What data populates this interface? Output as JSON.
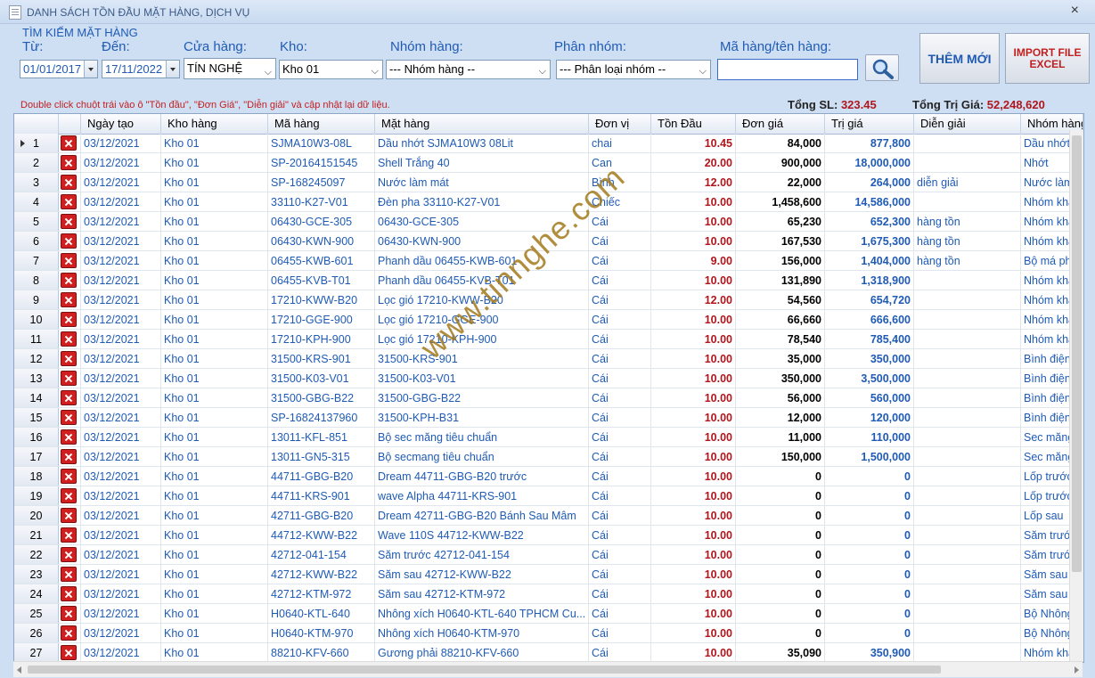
{
  "window": {
    "title": "DANH SÁCH TỒN ĐẦU MẶT HÀNG, DỊCH VỤ",
    "close_glyph": "×"
  },
  "search": {
    "title": "TÌM KIẾM MẶT HÀNG",
    "from_label": "Từ:",
    "from_value": "01/01/2017",
    "to_label": "Đến:",
    "to_value": "17/11/2022",
    "store_label": "Cửa hàng:",
    "store_value": "TÍN NGHỆ",
    "warehouse_label": "Kho:",
    "warehouse_value": "Kho 01",
    "group_label": "Nhóm hàng:",
    "group_value": "--- Nhóm hàng --",
    "subgroup_label": "Phân nhóm:",
    "subgroup_value": "--- Phân loại nhóm --",
    "code_label": "Mã hàng/tên hàng:",
    "code_value": "",
    "chevron": "⌵"
  },
  "buttons": {
    "add": "THÊM MỚI",
    "import_line1": "IMPORT FILE",
    "import_line2": "EXCEL"
  },
  "hint": "Double click chuột trái vào ô \"Tồn đầu\", \"Đơn Giá\", \"Diễn giải\" và cập nhật lại dữ liệu.",
  "summary": {
    "qty_label": "Tổng SL:",
    "qty_value": "323.45",
    "value_label": "Tổng Trị Giá:",
    "value_value": "52,248,620"
  },
  "columns": [
    "Ngày tạo",
    "Kho hàng",
    "Mã hàng",
    "Mặt hàng",
    "Đơn vị",
    "Tồn Đầu",
    "Đơn giá",
    "Trị giá",
    "Diễn giải",
    "Nhóm hàng"
  ],
  "rows": [
    [
      "1",
      "03/12/2021",
      "Kho 01",
      "SJMA10W3-08L",
      "Dầu nhớt SJMA10W3 08Lit",
      "chai",
      "10.45",
      "84,000",
      "877,800",
      "",
      "Dầu nhớt"
    ],
    [
      "2",
      "03/12/2021",
      "Kho 01",
      "SP-20164151545",
      "Shell Trắng 40",
      "Can",
      "20.00",
      "900,000",
      "18,000,000",
      "",
      "Nhớt"
    ],
    [
      "3",
      "03/12/2021",
      "Kho 01",
      "SP-168245097",
      "Nước làm mát",
      "Bình",
      "12.00",
      "22,000",
      "264,000",
      "diễn giải",
      "Nước làm mát"
    ],
    [
      "4",
      "03/12/2021",
      "Kho 01",
      "33110-K27-V01",
      "Đèn pha 33110-K27-V01",
      "Chiếc",
      "10.00",
      "1,458,600",
      "14,586,000",
      "",
      "Nhóm khác"
    ],
    [
      "5",
      "03/12/2021",
      "Kho 01",
      "06430-GCE-305",
      "06430-GCE-305",
      "Cái",
      "10.00",
      "65,230",
      "652,300",
      "hàng tồn",
      "Nhóm khác"
    ],
    [
      "6",
      "03/12/2021",
      "Kho 01",
      "06430-KWN-900",
      "06430-KWN-900",
      "Cái",
      "10.00",
      "167,530",
      "1,675,300",
      "hàng tồn",
      "Nhóm khác"
    ],
    [
      "7",
      "03/12/2021",
      "Kho 01",
      "06455-KWB-601",
      "Phanh dầu 06455-KWB-601",
      "Cái",
      "9.00",
      "156,000",
      "1,404,000",
      "hàng tồn",
      "Bộ má phanh"
    ],
    [
      "8",
      "03/12/2021",
      "Kho 01",
      "06455-KVB-T01",
      "Phanh dầu 06455-KVB-T01",
      "Cái",
      "10.00",
      "131,890",
      "1,318,900",
      "",
      "Nhóm khác"
    ],
    [
      "9",
      "03/12/2021",
      "Kho 01",
      "17210-KWW-B20",
      "Lọc gió 17210-KWW-B20",
      "Cái",
      "12.00",
      "54,560",
      "654,720",
      "",
      "Nhóm khác"
    ],
    [
      "10",
      "03/12/2021",
      "Kho 01",
      "17210-GGE-900",
      "Lọc gió 17210-GGE-900",
      "Cái",
      "10.00",
      "66,660",
      "666,600",
      "",
      "Nhóm khác"
    ],
    [
      "11",
      "03/12/2021",
      "Kho 01",
      "17210-KPH-900",
      "Lọc gió 17210-KPH-900",
      "Cái",
      "10.00",
      "78,540",
      "785,400",
      "",
      "Nhóm khác"
    ],
    [
      "12",
      "03/12/2021",
      "Kho 01",
      "31500-KRS-901",
      "31500-KRS-901",
      "Cái",
      "10.00",
      "35,000",
      "350,000",
      "",
      "Bình điện"
    ],
    [
      "13",
      "03/12/2021",
      "Kho 01",
      "31500-K03-V01",
      "31500-K03-V01",
      "Cái",
      "10.00",
      "350,000",
      "3,500,000",
      "",
      "Bình điện"
    ],
    [
      "14",
      "03/12/2021",
      "Kho 01",
      "31500-GBG-B22",
      "31500-GBG-B22",
      "Cái",
      "10.00",
      "56,000",
      "560,000",
      "",
      "Bình điện"
    ],
    [
      "15",
      "03/12/2021",
      "Kho 01",
      "SP-16824137960",
      "31500-KPH-B31",
      "Cái",
      "10.00",
      "12,000",
      "120,000",
      "",
      "Bình điện"
    ],
    [
      "16",
      "03/12/2021",
      "Kho 01",
      "13011-KFL-851",
      "Bộ sec măng tiêu chuẩn",
      "Cái",
      "10.00",
      "11,000",
      "110,000",
      "",
      "Sec măng"
    ],
    [
      "17",
      "03/12/2021",
      "Kho 01",
      "13011-GN5-315",
      "Bộ secmang tiêu chuẩn",
      "Cái",
      "10.00",
      "150,000",
      "1,500,000",
      "",
      "Sec măng"
    ],
    [
      "18",
      "03/12/2021",
      "Kho 01",
      "44711-GBG-B20",
      "Dream 44711-GBG-B20 trước",
      "Cái",
      "10.00",
      "0",
      "0",
      "",
      "Lốp trước"
    ],
    [
      "19",
      "03/12/2021",
      "Kho 01",
      "44711-KRS-901",
      "wave Alpha 44711-KRS-901",
      "Cái",
      "10.00",
      "0",
      "0",
      "",
      "Lốp trước"
    ],
    [
      "20",
      "03/12/2021",
      "Kho 01",
      "42711-GBG-B20",
      "Dream 42711-GBG-B20 Bánh Sau Mâm",
      "Cái",
      "10.00",
      "0",
      "0",
      "",
      "Lốp sau"
    ],
    [
      "21",
      "03/12/2021",
      "Kho 01",
      "44712-KWW-B22",
      "Wave 110S 44712-KWW-B22",
      "Cái",
      "10.00",
      "0",
      "0",
      "",
      "Săm trước"
    ],
    [
      "22",
      "03/12/2021",
      "Kho 01",
      "42712-041-154",
      "Săm trước 42712-041-154",
      "Cái",
      "10.00",
      "0",
      "0",
      "",
      "Săm trước"
    ],
    [
      "23",
      "03/12/2021",
      "Kho 01",
      "42712-KWW-B22",
      "Săm sau 42712-KWW-B22",
      "Cái",
      "10.00",
      "0",
      "0",
      "",
      "Săm sau"
    ],
    [
      "24",
      "03/12/2021",
      "Kho 01",
      "42712-KTM-972",
      "Săm sau 42712-KTM-972",
      "Cái",
      "10.00",
      "0",
      "0",
      "",
      "Săm sau"
    ],
    [
      "25",
      "03/12/2021",
      "Kho 01",
      "H0640-KTL-640",
      "Nhông xích H0640-KTL-640 TPHCM Cu...",
      "Cái",
      "10.00",
      "0",
      "0",
      "",
      "Bộ Nhông xích"
    ],
    [
      "26",
      "03/12/2021",
      "Kho 01",
      "H0640-KTM-970",
      "Nhông xích H0640-KTM-970",
      "Cái",
      "10.00",
      "0",
      "0",
      "",
      "Bộ Nhông xích"
    ],
    [
      "27",
      "03/12/2021",
      "Kho 01",
      "88210-KFV-660",
      "Gương phải 88210-KFV-660",
      "Cái",
      "10.00",
      "35,090",
      "350,900",
      "",
      "Nhóm khác"
    ]
  ],
  "watermark": "www.tinnghe.com",
  "colors": {
    "accent": "#1f5bb5",
    "quantity": "#b0161c",
    "delete": "#d11f1f"
  }
}
